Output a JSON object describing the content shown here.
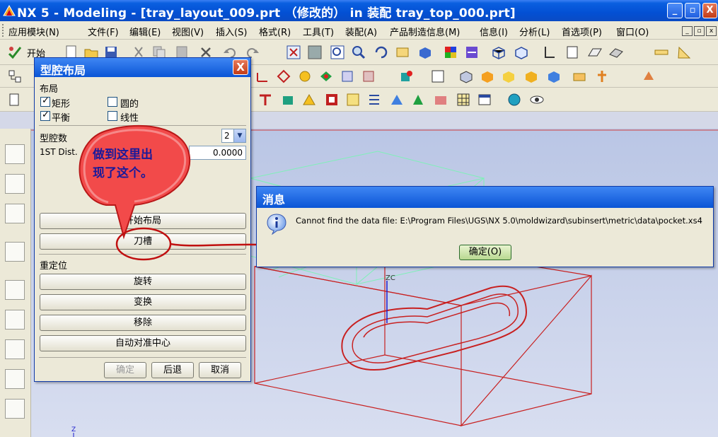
{
  "window": {
    "title": "NX 5 - Modeling - [tray_layout_009.prt （修改的）  in 装配 tray_top_000.prt]",
    "buttons": [
      "_",
      "▫",
      "X"
    ]
  },
  "menubar": {
    "items": [
      "应用模块(N)",
      "文件(F)",
      "编辑(E)",
      "视图(V)",
      "插入(S)",
      "格式(R)",
      "工具(T)",
      "装配(A)",
      "产品制造信息(M)",
      "信息(I)",
      "分析(L)",
      "首选项(P)",
      "窗口(O)"
    ]
  },
  "toolbar": {
    "start_label": "开始"
  },
  "layout_dialog": {
    "title": "型腔布局",
    "close": "X",
    "section_layout": "布局",
    "opt_rect": "矩形",
    "opt_circle": "圆的",
    "opt_balance": "平衡",
    "opt_linear": "线性",
    "cavity_count_label": "型腔数",
    "cavity_count_value": "2",
    "dist_label": "1ST Dist.",
    "dist_value": "0.0000",
    "btn_start_layout": "开始布局",
    "btn_pocket": "刀槽",
    "section_reposition": "重定位",
    "btn_rotate": "旋转",
    "btn_transform": "变换",
    "btn_remove": "移除",
    "btn_autocenter": "自动对准中心",
    "btn_ok": "确定",
    "btn_back": "后退",
    "btn_cancel": "取消"
  },
  "callout": {
    "line1": "做到这里出",
    "line2": "现了这个。"
  },
  "message_dialog": {
    "title": "消息",
    "text": "Cannot find the data file: E:\\Program Files\\UGS\\NX 5.0\\moldwizard\\subinsert\\metric\\data\\pocket.xs4",
    "ok_label": "确定(O)"
  },
  "viewport": {
    "zc_label": "ZC",
    "z_label": "Z"
  }
}
